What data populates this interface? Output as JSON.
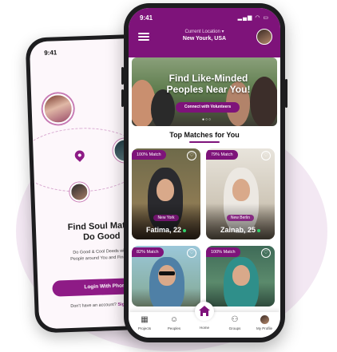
{
  "back_phone": {
    "time": "9:41",
    "title_line1": "Find Soul Mates",
    "title_line2": "Do Good",
    "subtitle_line1": "Do Good & Cool Deeds with L",
    "subtitle_line2": "People around You and Find You",
    "login_button": "Login With Phone",
    "footer_text": "Don't have an account?",
    "footer_link": "Sig"
  },
  "status_bar": {
    "time": "9:41",
    "icons": "▂▄▆ ◠ ▭"
  },
  "header": {
    "location_label": "Current Location ▾",
    "location_value": "New Yourk, USA"
  },
  "banner": {
    "title": "Find Like-Minded Peoples Near You!",
    "button": "Connect with Volunteers",
    "dots": "●○○"
  },
  "section": {
    "title": "Top Matches for You"
  },
  "matches": [
    {
      "badge": "100% Match",
      "city": "New York",
      "name": "Fatima, 22"
    },
    {
      "badge": "79% Match",
      "city": "New Berlin",
      "name": "Zainab, 25"
    },
    {
      "badge": "82% Match"
    },
    {
      "badge": "100% Match"
    }
  ],
  "nav": {
    "projects": "Projects",
    "peoples": "Peoples",
    "home": "Home",
    "groups": "Groups",
    "profile": "My Profile"
  },
  "colors": {
    "brand": "#7e137a",
    "blob": "#f3e8f3"
  }
}
